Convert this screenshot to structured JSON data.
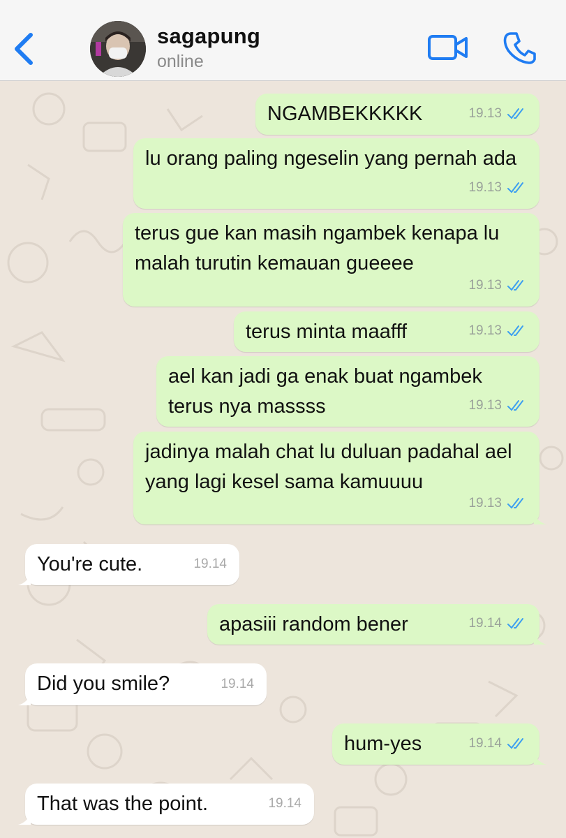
{
  "header": {
    "name": "sagapung",
    "status": "online"
  },
  "colors": {
    "accent": "#1f7cf2",
    "outgoing_bubble": "#dcf8c6",
    "incoming_bubble": "#ffffff",
    "read_ticks": "#3d9ff0"
  },
  "icons": {
    "back": "chevron-left-icon",
    "video": "video-camera-icon",
    "call": "phone-icon",
    "read": "double-check-icon"
  },
  "messages": [
    {
      "direction": "out",
      "text": "NGAMBEKKKKK",
      "time": "19.13"
    },
    {
      "direction": "out",
      "text": "lu orang paling ngeselin yang pernah ada",
      "time": "19.13"
    },
    {
      "direction": "out",
      "text": "terus gue kan masih ngambek kenapa lu malah turutin kemauan gueeee",
      "time": "19.13"
    },
    {
      "direction": "out",
      "text": "terus minta maafff",
      "time": "19.13"
    },
    {
      "direction": "out",
      "text": "ael kan jadi ga enak buat ngambek terus nya massss",
      "time": "19.13"
    },
    {
      "direction": "out",
      "text": "jadinya malah chat lu duluan padahal ael yang lagi kesel sama kamuuuu",
      "time": "19.13"
    },
    {
      "direction": "in",
      "text": "You're cute.",
      "time": "19.14"
    },
    {
      "direction": "out",
      "text": "apasiii random bener",
      "time": "19.14"
    },
    {
      "direction": "in",
      "text": "Did you smile?",
      "time": "19.14"
    },
    {
      "direction": "out",
      "text": "hum-yes",
      "time": "19.14"
    },
    {
      "direction": "in",
      "text": "That was the point.",
      "time": "19.14"
    }
  ]
}
